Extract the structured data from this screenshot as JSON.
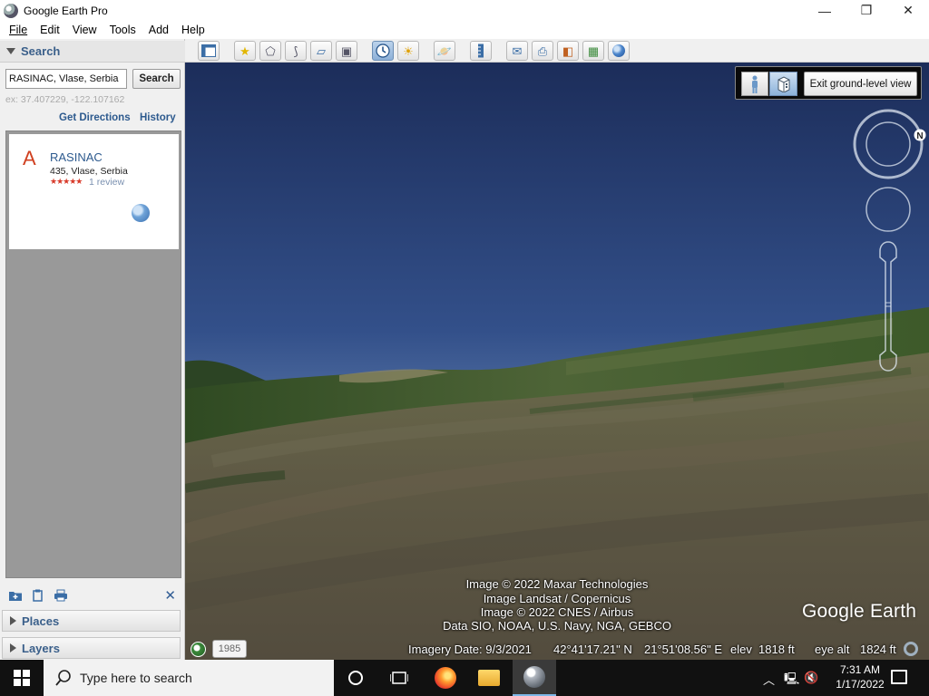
{
  "window": {
    "title": "Google Earth Pro",
    "controls": {
      "minimize": "—",
      "maximize": "❐",
      "close": "✕"
    }
  },
  "menu": [
    "File",
    "Edit",
    "View",
    "Tools",
    "Add",
    "Help"
  ],
  "search": {
    "header": "Search",
    "input_value": "RASINAC, Vlase, Serbia",
    "button_label": "Search",
    "example": "ex: 37.407229, -122.107162",
    "get_directions": "Get Directions",
    "history": "History"
  },
  "result": {
    "letter": "A",
    "name": "RASINAC",
    "address": "435, Vlase, Serbia",
    "stars": "★★★★★",
    "reviews": "1 review"
  },
  "panels": {
    "places": "Places",
    "layers": "Layers"
  },
  "toolbar": {
    "icons": [
      "sidebar-icon",
      "placemark-icon",
      "polygon-icon",
      "path-icon",
      "image-overlay-icon",
      "record-tour-icon",
      "historical-imagery-icon",
      "sunlight-icon",
      "planets-icon",
      "ruler-icon",
      "email-icon",
      "print-icon",
      "save-image-icon",
      "view-in-maps-icon",
      "earth-icon"
    ],
    "active": [
      "historical-imagery-icon"
    ]
  },
  "ground_level": {
    "exit_label": "Exit ground-level view"
  },
  "navigation": {
    "north_label": "N"
  },
  "attribution": [
    "Image © 2022 Maxar Technologies",
    "Image Landsat / Copernicus",
    "Image © 2022 CNES / Airbus",
    "Data SIO, NOAA, U.S. Navy, NGA, GEBCO"
  ],
  "logo": "Google Earth",
  "status": {
    "year": "1985",
    "imagery_date": "Imagery Date: 9/3/2021",
    "latitude": "42°41'17.21\" N",
    "longitude": "21°51'08.56\" E",
    "elev_label": "elev",
    "elev_value": "1818 ft",
    "eye_alt_label": "eye alt",
    "eye_alt_value": "1824 ft"
  },
  "taskbar": {
    "search_placeholder": "Type here to search",
    "time": "7:31 AM",
    "date": "1/17/2022"
  },
  "colors": {
    "sky_top": "#1c2d5a",
    "sky_horizon": "#7f9dc4",
    "link_blue": "#2d5a8e",
    "taskbar": "#111111"
  }
}
